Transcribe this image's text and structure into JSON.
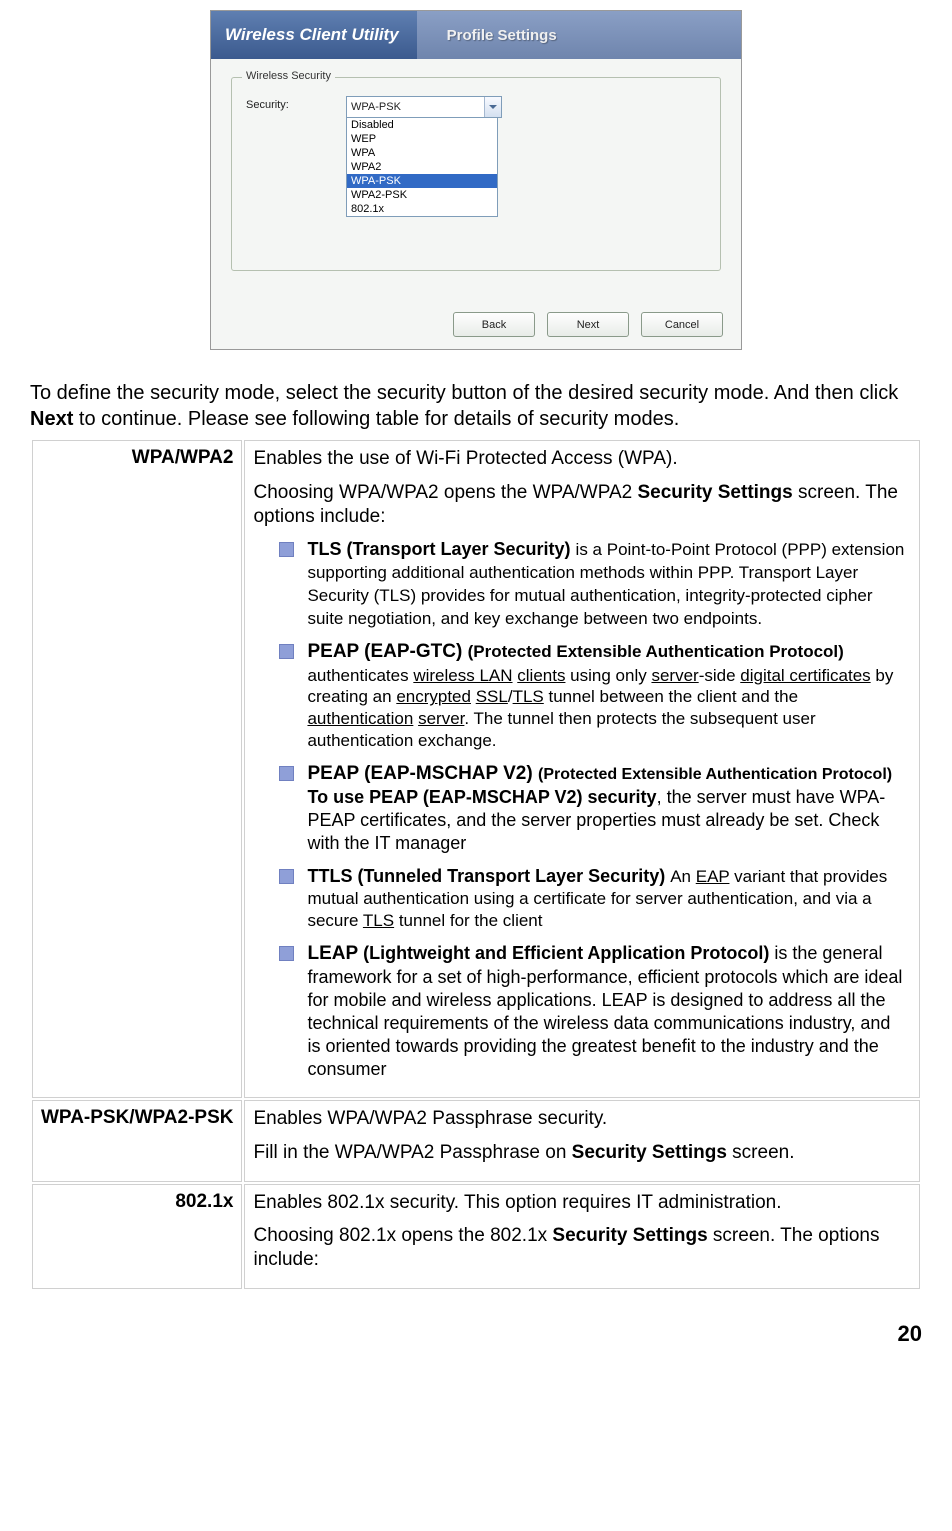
{
  "screenshot": {
    "app_title": "Wireless Client Utility",
    "tab_title": "Profile Settings",
    "group_label": "Wireless Security",
    "field_label": "Security:",
    "combo_value": "WPA-PSK",
    "options": [
      "Disabled",
      "WEP",
      "WPA",
      "WPA2",
      "WPA-PSK",
      "WPA2-PSK",
      "802.1x"
    ],
    "selected_index": 4,
    "buttons": {
      "back": "Back",
      "next": "Next",
      "cancel": "Cancel"
    }
  },
  "intro": {
    "line1a": "To define the security mode, select the security button of the desired security mode. And then click ",
    "next_bold": "Next",
    "line1b": " to continue. Please see following table for details of security modes."
  },
  "table": {
    "wpa": {
      "label": "WPA/WPA2",
      "p1": "Enables the use of Wi-Fi Protected Access (WPA).",
      "p2a": "Choosing WPA/WPA2 opens the WPA/WPA2 ",
      "p2b": "Security Settings",
      "p2c": " screen. The options include:",
      "items": {
        "tls": {
          "head": "TLS (Transport Layer Security) ",
          "body": "is a Point-to-Point Protocol (PPP) extension supporting additional authentication methods within PPP. Transport Layer Security (TLS) provides for mutual authentication, integrity-protected cipher suite negotiation, and key exchange between two endpoints."
        },
        "peap_gtc": {
          "head1": "PEAP (EAP-GTC)  ",
          "head2": "(Protected Extensible Authentication Protocol) ",
          "t1": "authenticates ",
          "u1": "wireless LAN",
          "t2": " ",
          "u2": "clients",
          "t3": " using only ",
          "u3": "server",
          "t4": "-side ",
          "u4": "digital certificates",
          "t5": " by creating an ",
          "u5": "encrypted",
          "t6": " ",
          "u6": "SSL",
          "t7": "/",
          "u7": "TLS",
          "t8": " tunnel between the client and the ",
          "u8": "authentication",
          "t9": " ",
          "u9": "server",
          "t10": ". The tunnel then protects the subsequent user authentication exchange."
        },
        "peap_ms": {
          "head1": "PEAP (EAP-MSCHAP V2) ",
          "head2": "(Protected Extensible Authentication Protocol) ",
          "head3": "To use PEAP (EAP-MSCHAP V2) security",
          "body": ", the server must have WPA-PEAP certificates, and the server properties must already be set. Check with the IT manager"
        },
        "ttls": {
          "head": "TTLS  (Tunneled Transport Layer Security) ",
          "t1": "An ",
          "u1": "EAP",
          "t2": " variant that provides mutual authentication using a certificate for server authentication, and via a secure ",
          "u2": "TLS",
          "t3": " tunnel for the client"
        },
        "leap": {
          "head1": "LEAP    ",
          "head2": "(Lightweight and Efficient Application Protocol)",
          "body": " is the general framework for a set of high-performance, efficient protocols which are ideal for mobile and wireless applications. LEAP is designed to address all the technical requirements of the wireless data communications industry, and is oriented towards providing the greatest benefit to the industry and the consumer"
        }
      }
    },
    "psk": {
      "label": "WPA-PSK/WPA2-PSK",
      "p1": "Enables WPA/WPA2 Passphrase security.",
      "p2a": "Fill in the WPA/WPA2 Passphrase on ",
      "p2b": "Security Settings",
      "p2c": " screen."
    },
    "dot1x": {
      "label": "802.1x",
      "p1": "Enables 802.1x security.   This option requires IT administration.",
      "p2a": "Choosing 802.1x opens the 802.1x ",
      "p2b": "Security Settings",
      "p2c": " screen. The options include:"
    }
  },
  "page_number": "20"
}
